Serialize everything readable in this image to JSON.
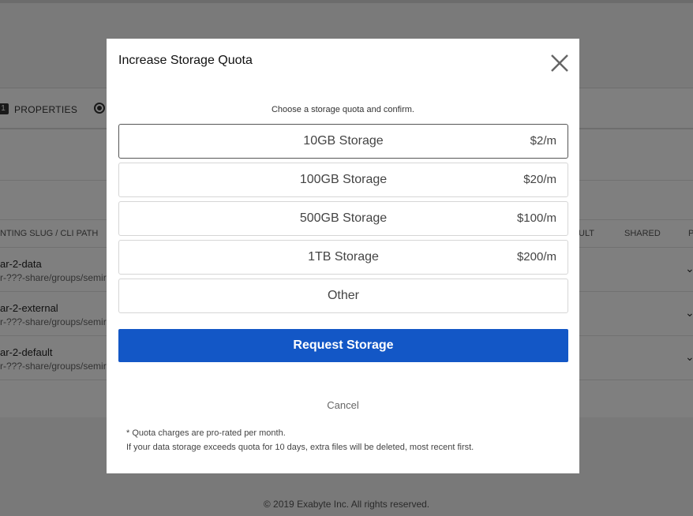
{
  "background": {
    "tab_number": "1",
    "tab_label": "PROPERTIES",
    "table_headers": {
      "slug_path": "NTING SLUG / CLI PATH",
      "default": "ULT",
      "shared": "SHARED",
      "p": "P"
    },
    "rows": [
      {
        "name": "ar-2-data",
        "path": "r-???-share/groups/semir"
      },
      {
        "name": "ar-2-external",
        "path": "r-???-share/groups/semir"
      },
      {
        "name": "ar-2-default",
        "path": "r-???-share/groups/semir"
      }
    ],
    "footer": "© 2019 Exabyte Inc. All rights reserved."
  },
  "modal": {
    "title": "Increase Storage Quota",
    "subtitle": "Choose a storage quota and confirm.",
    "options": [
      {
        "label": "10GB Storage",
        "price": "$2/m",
        "selected": true
      },
      {
        "label": "100GB Storage",
        "price": "$20/m"
      },
      {
        "label": "500GB Storage",
        "price": "$100/m"
      },
      {
        "label": "1TB Storage",
        "price": "$200/m"
      },
      {
        "label": "Other",
        "price": ""
      }
    ],
    "request_label": "Request Storage",
    "cancel_label": "Cancel",
    "note_1": "* Quota charges are pro-rated per month.",
    "note_2": "If your data storage exceeds quota for 10 days, extra files will be deleted, most recent first."
  },
  "colors": {
    "accent": "#1357c6",
    "overlay": "rgba(0,0,0,0.5)"
  },
  "icons": {
    "close": "close-icon",
    "chevron": "chevron-down-icon",
    "radio": "radio-icon"
  }
}
